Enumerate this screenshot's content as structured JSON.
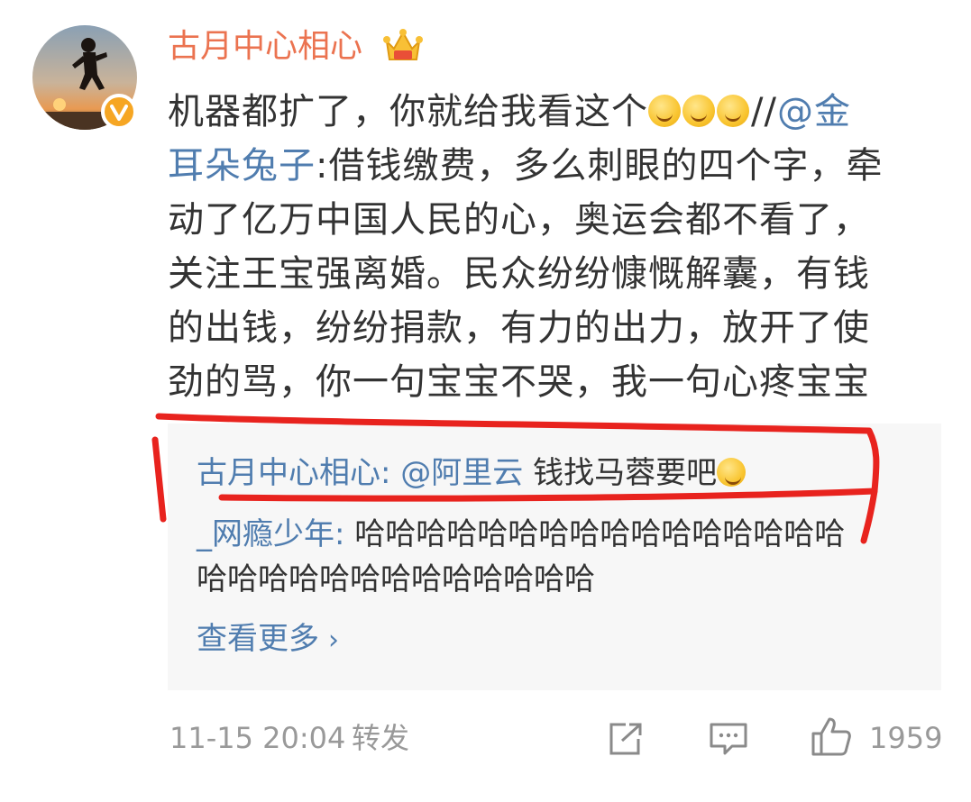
{
  "post": {
    "username": "古月中心相心",
    "lines": [
      {
        "pre": "机器都扩了，你就给我看这个",
        "mid": "//",
        "link": "@金"
      },
      {
        "link": "耳朵兔子",
        "rest": ":借钱缴费，多么刺眼的四个字，牵"
      },
      {
        "text": "动了亿万中国人民的心，奥运会都不看了，"
      },
      {
        "text": "关注王宝强离婚。民众纷纷慷慨解囊，有钱"
      },
      {
        "text": "的出钱，纷纷捐款，有力的出力，放开了使"
      },
      {
        "text": "劲的骂，你一句宝宝不哭，我一句心疼宝宝"
      }
    ]
  },
  "comments": [
    {
      "name": "古月中心相心:",
      "mention": "@阿里云",
      "text": " 钱找马蓉要吧"
    },
    {
      "name": "_网瘾少年:",
      "text": " 哈哈哈哈哈哈哈哈哈哈哈哈哈哈哈哈哈哈哈哈哈哈哈哈哈哈哈哈哈哈哈",
      "line1": " 哈哈哈哈哈哈哈哈哈哈哈哈哈哈哈哈",
      "line2": "哈哈哈哈哈哈哈哈哈哈哈哈哈"
    }
  ],
  "view_more": "查看更多",
  "footer": {
    "timestamp": "11-15 20:04",
    "repost_label": "转发",
    "like_count": "1959"
  },
  "colors": {
    "username": "#eb7350",
    "link": "#507daf",
    "annotation": "#e8231e",
    "comment_bg": "#f7f7f7"
  },
  "icons": [
    "avatar",
    "verified-badge-icon",
    "vip-crown-icon",
    "grin-emoji-icon",
    "thinking-emoji-icon",
    "share-icon",
    "comment-icon",
    "thumbs-up-icon",
    "chevron-right-icon"
  ]
}
